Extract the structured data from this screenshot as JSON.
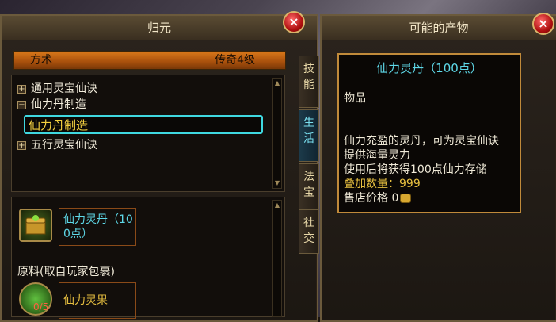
{
  "left_panel": {
    "title": "归元",
    "header": {
      "left": "方术",
      "right": "传奇4级"
    },
    "tree": [
      {
        "toggle": "+",
        "label": "通用灵宝仙诀"
      },
      {
        "toggle": "−",
        "label": "仙力丹制造"
      },
      {
        "toggle": "+",
        "label": "五行灵宝仙诀"
      }
    ],
    "selected": "仙力丹制造",
    "product": {
      "name_line1": "仙力灵丹（10",
      "name_line2": "0点）"
    },
    "materials_label": "原料(取自玩家包裹)",
    "material": {
      "name": "仙力灵果",
      "count": "0/5"
    }
  },
  "side_tabs": [
    {
      "label": "技\n能",
      "active": false
    },
    {
      "label": "生\n活",
      "active": true
    },
    {
      "label": "法\n宝",
      "active": false
    },
    {
      "label": "社\n交",
      "active": false
    }
  ],
  "right_panel": {
    "title": "可能的产物",
    "item_title": "仙力灵丹（100点）",
    "category": "物品",
    "desc_1": "仙力充盈的灵丹，可为灵宝仙诀",
    "desc_2": "提供海量灵力",
    "desc_3": "使用后将获得100点仙力存储",
    "stack_label": "叠加数量：",
    "stack_value": "999",
    "price_label": "售店价格",
    "price_value": "0"
  },
  "colors": {
    "accent_cyan": "#3fd8e0",
    "gold": "#e8c040",
    "frame": "#6b5a3c"
  }
}
